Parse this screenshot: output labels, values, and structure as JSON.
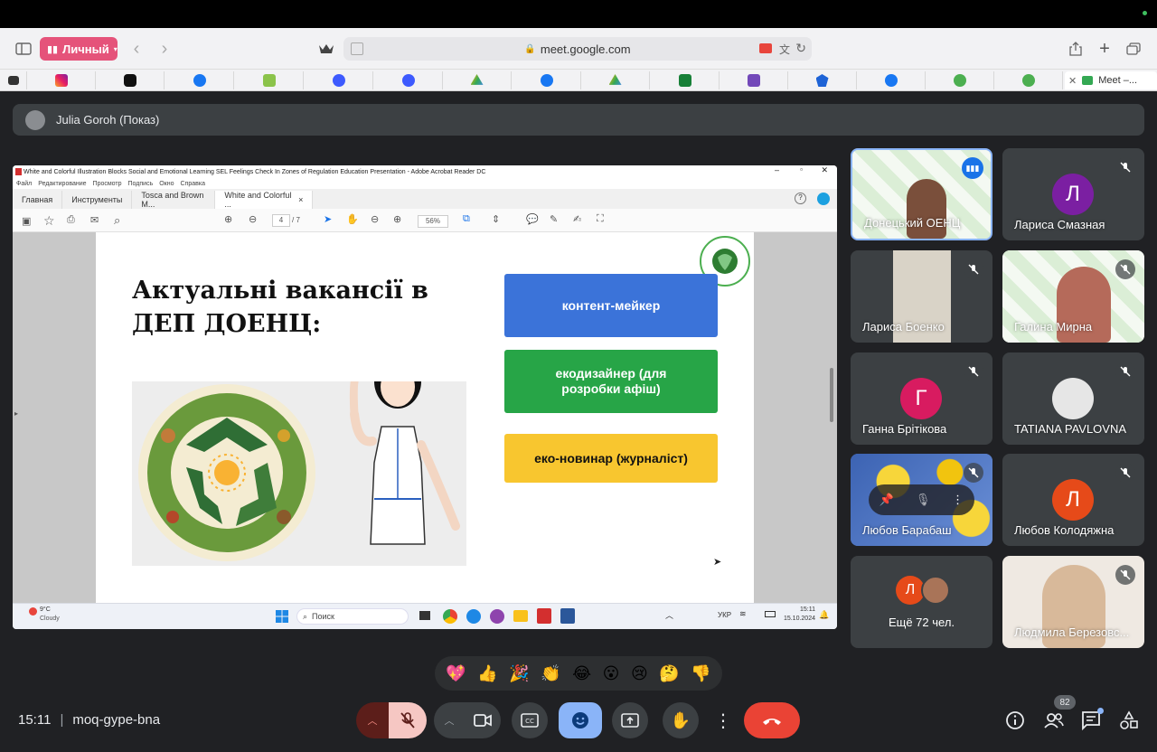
{
  "browser": {
    "profile_label": "Личный",
    "url": "meet.google.com",
    "tab_title": "Meet –..."
  },
  "meet": {
    "presenter_label": "Julia Goroh (Показ)",
    "time": "15:11",
    "meeting_code": "moq-gype-bna",
    "participant_count": "82"
  },
  "acrobat": {
    "title": "White and Colorful Illustration Blocks Social and Emotional Learning SEL Feelings Check In Zones of Regulation Education Presentation - Adobe Acrobat Reader DC",
    "menu": [
      "Файл",
      "Редактирование",
      "Просмотр",
      "Подпись",
      "Окно",
      "Справка"
    ],
    "tabs": [
      "Главная",
      "Инструменты",
      "Tosca and Brown M...",
      "White and Colorful ..."
    ],
    "page_current": "4",
    "page_total": "/ 7",
    "zoom": "56%"
  },
  "slide": {
    "title_line1": "Актуальні вакансії в",
    "title_line2": "ДЕП ДОЕНЦ:",
    "vacancies": [
      "контент-мейкер",
      "екодизайнер (для розробки афіш)",
      "еко-новинар (журналіст)"
    ]
  },
  "taskbar": {
    "weather_temp": "9°C",
    "weather_desc": "Cloudy",
    "search": "Поиск",
    "lang": "УКР",
    "time": "15:11",
    "date": "15.10.2024"
  },
  "participants": [
    {
      "name": "Донецький ОЕНЦ"
    },
    {
      "name": "Лариса Смазная",
      "initial": "Л"
    },
    {
      "name": "Лариса Боенко"
    },
    {
      "name": "Галина Мирна"
    },
    {
      "name": "Ганна Брiтiкова",
      "initial": "Г"
    },
    {
      "name": "TATIANA PAVLOVNA"
    },
    {
      "name": "Любов Барабаш"
    },
    {
      "name": "Любов Колодяжна",
      "initial": "Л"
    },
    {
      "name": "Ещё 72 чел.",
      "initial": "Л"
    },
    {
      "name": "Людмила Березовс..."
    }
  ],
  "reactions": [
    "💖",
    "👍",
    "🎉",
    "👏",
    "😂",
    "😮",
    "😢",
    "🤔",
    "👎"
  ],
  "colors": {
    "vac_blue": "#3b73d9",
    "vac_green": "#27a547",
    "vac_yellow": "#f8c62f",
    "end_call": "#ea4335",
    "mic_off": "#f6c7c3",
    "emoji_active": "#8ab4f8"
  }
}
